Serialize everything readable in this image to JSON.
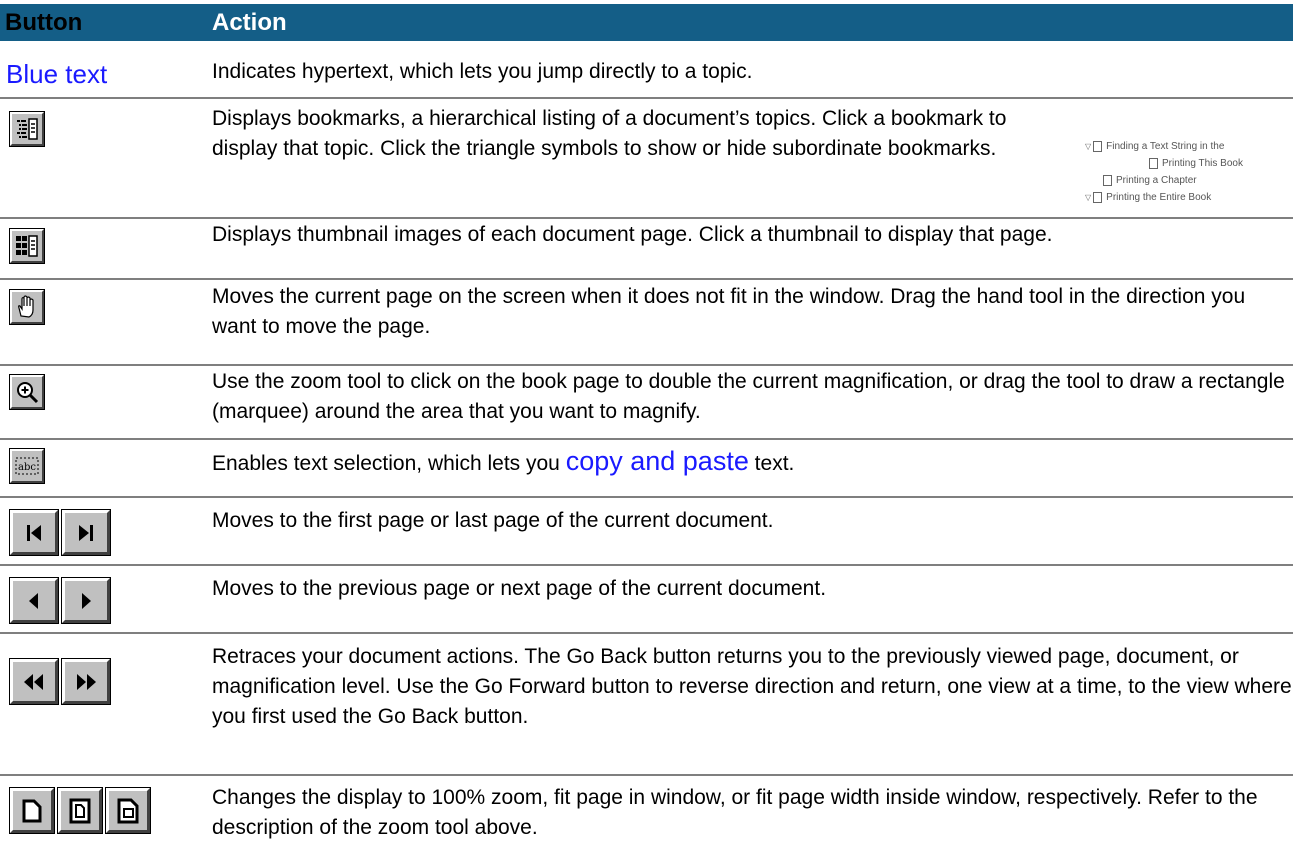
{
  "header": {
    "button_col": "Button",
    "action_col": "Action"
  },
  "rows": [
    {
      "button_label": "Blue text",
      "action": "Indicates hypertext, which lets you jump directly to a topic."
    },
    {
      "icon": "bookmarks-icon",
      "action": "Displays bookmarks, a hierarchical listing of a document’s topics. Click a bookmark to display that topic. Click the triangle symbols to show or hide subordinate bookmarks."
    },
    {
      "icon": "thumbnails-icon",
      "action": "Displays thumbnail images of each document page. Click a thumbnail to display that page."
    },
    {
      "icon": "hand-tool-icon",
      "action": "Moves the current page on the screen when it does not fit in the window. Drag the hand tool in the direction you want to move the page."
    },
    {
      "icon": "zoom-tool-icon",
      "action": "Use the zoom tool to click on the book page to double the current magnification, or drag the tool to draw a rectangle (marquee) around the area that you want to magnify."
    },
    {
      "icon": "text-select-icon",
      "action_pre": "Enables text selection, which lets you ",
      "action_link": "copy and paste",
      "action_post": " text."
    },
    {
      "icons": [
        "first-page-icon",
        "last-page-icon"
      ],
      "action": "Moves to the first page or last page of the current document."
    },
    {
      "icons": [
        "previous-page-icon",
        "next-page-icon"
      ],
      "action": "Moves to the previous page or next page of the current document."
    },
    {
      "icons": [
        "go-back-icon",
        "go-forward-icon"
      ],
      "action": "Retraces your document actions. The Go Back button returns you to the previously viewed page, document, or magnification level. Use the Go Forward button to reverse direction and return, one view at a time, to the view where you first used the Go Back button."
    },
    {
      "icons": [
        "actual-size-icon",
        "fit-page-icon",
        "fit-width-icon"
      ],
      "action": "Changes the display to 100% zoom, fit page in window, or fit page width inside window, respectively. Refer to the description of the zoom tool above."
    }
  ],
  "bookmark_preview": [
    "Finding a Text String in the",
    "Printing This Book",
    "Printing a Chapter",
    "Printing the Entire Book"
  ],
  "colors": {
    "header_bg": "#145e87",
    "link": "#1a1aff",
    "button_face": "#c0c0c0"
  }
}
